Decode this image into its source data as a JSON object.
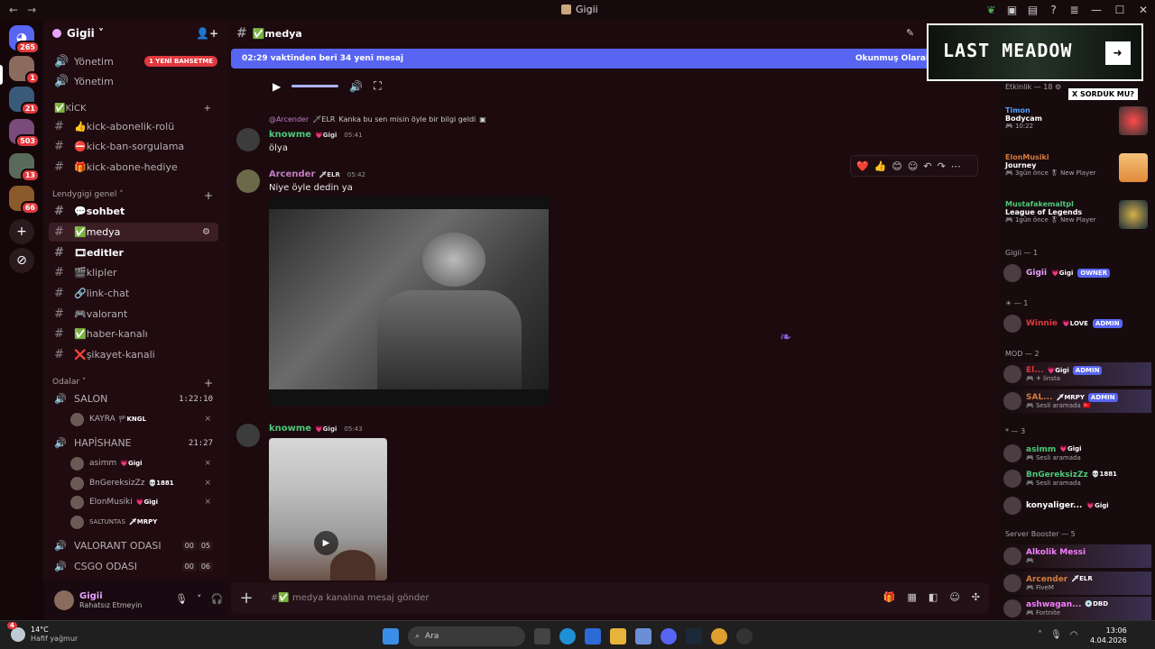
{
  "window": {
    "title": "Gigii",
    "back": "←",
    "fwd": "→"
  },
  "server": {
    "name": "Gigii ˅"
  },
  "guild_badges": [
    "265",
    "1",
    "21",
    "503",
    "13",
    "66"
  ],
  "mention_pill": "1 YENİ BAHSETME",
  "channels_top": [
    {
      "icon": "🔊",
      "label": "Yönetim"
    },
    {
      "icon": "🔊",
      "label": "Yönetim"
    },
    {
      "icon": "",
      "label": "✅KİCK"
    },
    {
      "icon": "#",
      "label": "👍kick-abonelik-rolü"
    },
    {
      "icon": "#",
      "label": "⛔kick-ban-sorgulama"
    },
    {
      "icon": "#",
      "label": "🎁kick-abone-hediye"
    }
  ],
  "category_lendy": "Lendygigi genel ˅",
  "channels_lendy": [
    {
      "label": "💬sohbet"
    },
    {
      "label": "✅medya"
    },
    {
      "label": "🎞editler"
    },
    {
      "label": "🎬klipler"
    },
    {
      "label": "🔗link-chat"
    },
    {
      "label": "🎮valorant"
    },
    {
      "label": "✅haber-kanalı"
    },
    {
      "label": "❌şikayet-kanali"
    }
  ],
  "category_odalar": "Odalar ˅",
  "voice": [
    {
      "label": "SALON",
      "time": "1:22:10",
      "users": [
        {
          "name": "KAYRA",
          "tag": "🏴KNGL"
        }
      ]
    },
    {
      "label": "HAPİSHANE",
      "time": "21:27",
      "users": [
        {
          "name": "asimm",
          "tag": "💗Gigi"
        },
        {
          "name": "BnGereksizZz",
          "tag": "💀1881"
        },
        {
          "name": "ElonMusiki",
          "tag": "💗Gigi"
        },
        {
          "name": "SALTUNTAS",
          "tag": "🗡MRPY"
        }
      ]
    },
    {
      "label": "VALORANT ODASI",
      "a": "00",
      "b": "05"
    },
    {
      "label": "CSGO ODASI",
      "a": "00",
      "b": "06"
    }
  ],
  "user": {
    "name": "Gigii",
    "status": "Rahatsız Etmeyin"
  },
  "channel": {
    "name": "✅medya"
  },
  "new_banner": {
    "left": "02:29 vaktinden beri 34 yeni mesaj",
    "right": "Okunmuş Olarak"
  },
  "messages": {
    "reply_author": "@Arcender",
    "reply_tag": "🗡ELR",
    "reply_text": "Kanka bu sen misin öyle bir bilgi geldi",
    "m1": {
      "author": "knowme",
      "tag": "💗Gigi",
      "time": "05:41",
      "text": "ölya"
    },
    "m2": {
      "author": "Arcender",
      "tag": "🗡ELR",
      "time": "05:42",
      "text": "Niye öyle dedin ya"
    },
    "m3": {
      "author": "knowme",
      "tag": "💗Gigi",
      "time": "05:43"
    }
  },
  "hover_toolbar": [
    "❤️",
    "👍",
    "😊",
    "☺",
    "↶",
    "↷",
    "⋯"
  ],
  "composer_placeholder": "#✅ medya kanalına mesaj gönder",
  "ad": {
    "title": "LAST MEADOW",
    "tag": "X SORDUK MU?"
  },
  "members": {
    "activity_header": "Etkinlik — 18 ⚙",
    "activities": [
      {
        "name": "Timon",
        "game": "Bodycam",
        "sub": "🎮 10:22"
      },
      {
        "name": "ElonMusiki",
        "game": "Journey",
        "sub": "🎮 3gün önce  🎖 New Player"
      },
      {
        "name": "Mustafakemaltpl",
        "game": "League of Legends",
        "sub": "🎮 1gün önce  🎖 New Player"
      }
    ],
    "groups": [
      {
        "header": "Gigii — 1",
        "items": [
          {
            "name": "Gigii",
            "tag": "💗Gigi",
            "role": "OWNER",
            "sub": ""
          }
        ]
      },
      {
        "header": "☀ — 1",
        "items": [
          {
            "name": "Winnie",
            "tag": "💗LOVE",
            "role": "ADMIN",
            "sub": ""
          }
        ]
      },
      {
        "header": "MOD — 2",
        "items": [
          {
            "name": "El...",
            "tag": "💗Gigi",
            "role": "ADMIN",
            "sub": "🎮 ✈ linsta"
          },
          {
            "name": "SAL...",
            "tag": "🗡MRPY",
            "role": "ADMIN",
            "sub": "🎮 Sesli aramada 🇹🇷"
          }
        ]
      },
      {
        "header": "* — 3",
        "items": [
          {
            "name": "asimm",
            "tag": "💗Gigi",
            "role": "",
            "sub": "🎮 Sesli aramada"
          },
          {
            "name": "BnGereksizZz",
            "tag": "💀1881",
            "role": "",
            "sub": "🎮 Sesli aramada"
          },
          {
            "name": "konyaliger...",
            "tag": "💗Gigi",
            "role": "",
            "sub": ""
          }
        ]
      },
      {
        "header": "Server Booster — 5",
        "items": [
          {
            "name": "Alkolik Messi",
            "tag": "",
            "role": "",
            "sub": "🎮"
          },
          {
            "name": "Arcender",
            "tag": "🗡ELR",
            "role": "",
            "sub": "🎮 FiveM"
          },
          {
            "name": "ashwagan...",
            "tag": "💿DBD",
            "role": "",
            "sub": "🎮 Fortnite"
          }
        ]
      }
    ]
  },
  "taskbar": {
    "temp": "14°C",
    "weather": "Hafif yağmur",
    "badge": "4",
    "search": "Ara",
    "time": "13:06",
    "date": "4.04.2026"
  }
}
